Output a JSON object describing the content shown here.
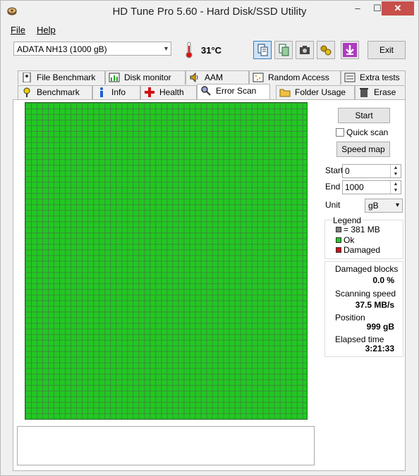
{
  "window": {
    "title": "HD Tune Pro 5.60 - Hard Disk/SSD Utility",
    "min": "–",
    "max": "☐",
    "close": "✕"
  },
  "menu": {
    "file": "File",
    "help": "Help"
  },
  "toolbar": {
    "drive": "ADATA   NH13 (1000 gB)",
    "temperature": "31°C",
    "exit_label": "Exit",
    "icons": [
      "copy-text-icon",
      "copy-screenshot-icon",
      "camera-icon",
      "options-icon",
      "download-icon"
    ]
  },
  "tabs_top": [
    {
      "label": "File Benchmark",
      "icon": "file-benchmark-icon"
    },
    {
      "label": "Disk monitor",
      "icon": "disk-monitor-icon"
    },
    {
      "label": "AAM",
      "icon": "speaker-icon"
    },
    {
      "label": "Random Access",
      "icon": "random-access-icon"
    },
    {
      "label": "Extra tests",
      "icon": "extra-tests-icon"
    }
  ],
  "tabs_bottom": [
    {
      "label": "Benchmark",
      "icon": "benchmark-icon"
    },
    {
      "label": "Info",
      "icon": "info-icon"
    },
    {
      "label": "Health",
      "icon": "health-cross-icon"
    },
    {
      "label": "Error Scan",
      "icon": "magnifier-icon",
      "active": true
    },
    {
      "label": "Folder Usage",
      "icon": "folder-icon"
    },
    {
      "label": "Erase",
      "icon": "trash-icon"
    }
  ],
  "scan": {
    "start_button": "Start",
    "quick_scan": "Quick scan",
    "quick_scan_checked": false,
    "speed_map_button": "Speed map",
    "start_label": "Start",
    "start_value": "0",
    "end_label": "End",
    "end_value": "1000",
    "unit_label": "Unit",
    "unit_value": "gB",
    "blocks_ok_fraction": 1.0
  },
  "legend": {
    "title": "Legend",
    "block_size": "= 381 MB",
    "ok": "Ok",
    "damaged": "Damaged",
    "colors": {
      "block": "#808080",
      "ok": "#22c822",
      "damaged": "#d01010"
    }
  },
  "stats": {
    "damaged_blocks_label": "Damaged blocks",
    "damaged_blocks_value": "0.0 %",
    "scanning_speed_label": "Scanning speed",
    "scanning_speed_value": "37.5 MB/s",
    "position_label": "Position",
    "position_value": "999 gB",
    "elapsed_label": "Elapsed time",
    "elapsed_value": "3:21:33"
  }
}
